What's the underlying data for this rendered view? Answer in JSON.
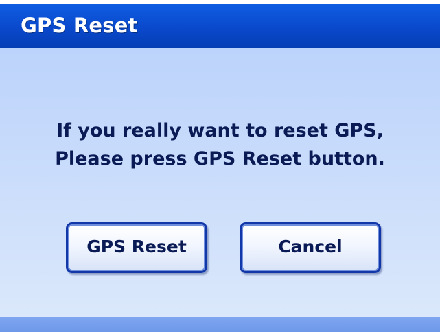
{
  "dialog": {
    "title": "GPS Reset",
    "message_line1": "If you really want to reset GPS,",
    "message_line2": "Please press GPS Reset button."
  },
  "buttons": {
    "confirm_label": "GPS Reset",
    "cancel_label": "Cancel"
  },
  "colors": {
    "title_bar": "#0a49cc",
    "body_background": "#c9dcfb",
    "button_border": "#1237a9",
    "text": "#0a1a55"
  }
}
